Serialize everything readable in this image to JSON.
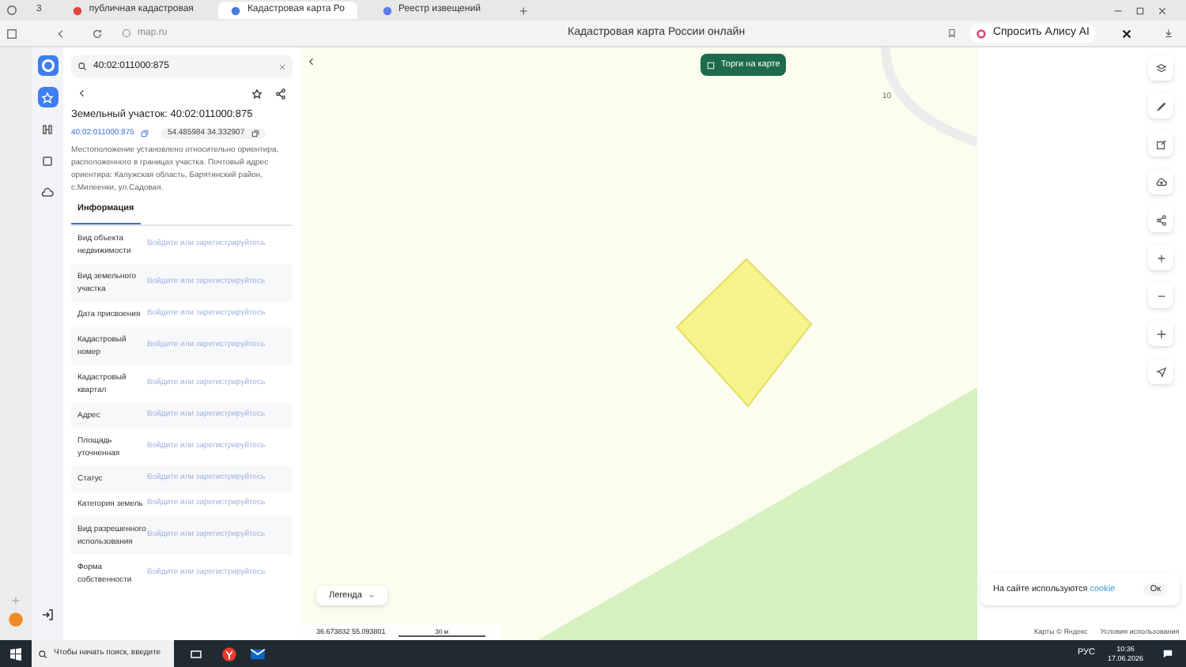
{
  "browser": {
    "tab_count": "3",
    "tabs": [
      {
        "label": "публичная кадастровая",
        "selected": false
      },
      {
        "label": "Кадастровая карта Ро",
        "selected": true
      },
      {
        "label": "Реестр извещений",
        "selected": false
      }
    ],
    "address": "map.ru",
    "page_title": "Кадастровая карта России онлайн",
    "alice": "Спросить Алису AI"
  },
  "rail": [
    {
      "kind": "star",
      "selected": true
    },
    {
      "kind": "ruler",
      "selected": false
    },
    {
      "kind": "square",
      "selected": false
    },
    {
      "kind": "cloud",
      "selected": false
    }
  ],
  "panel": {
    "search": "40:02:011000:875",
    "title": "Земельный участок: 40:02:011000:875",
    "number": "40:02:011000:875",
    "coords": "54.485984 34.332907",
    "description": "Местоположение установлено относительно ориентира, расположенного в границах участка. Почтовый адрес ориентира: Калужская область, Барятинский район, с.Милеенки, ул.Садовая.",
    "tab": "Информация",
    "rows": [
      {
        "label": "Вид объекта недвижимости",
        "value": "Войдите или зарегистрируйтесь"
      },
      {
        "label": "Вид земельного участка",
        "value": "Войдите или зарегистрируйтесь"
      },
      {
        "label": "Дата присвоения",
        "value": "Войдите или зарегистрируйтесь"
      },
      {
        "label": "Кадастровый номер",
        "value": "Войдите или зарегистрируйтесь"
      },
      {
        "label": "Кадастровый квартал",
        "value": "Войдите или зарегистрируйтесь"
      },
      {
        "label": "Адрес",
        "value": "Войдите или зарегистрируйтесь"
      },
      {
        "label": "Площадь уточненная",
        "value": "Войдите или зарегистрируйтесь"
      },
      {
        "label": "Статус",
        "value": "Войдите или зарегистрируйтесь"
      },
      {
        "label": "Категория земель",
        "value": "Войдите или зарегистрируйтесь"
      },
      {
        "label": "Вид разрешенного использования",
        "value": "Войдите или зарегистрируйтесь"
      },
      {
        "label": "Форма собственности",
        "value": "Войдите или зарегистрируйтесь"
      }
    ]
  },
  "map": {
    "auction_button": "Торги на карте",
    "label": "10",
    "legend": "Легенда",
    "coordinates": "36.673832 55.093801",
    "scale": "30 м",
    "cookie_text": "На сайте используются",
    "cookie_link": "cookie",
    "cookie_ok": "Ок",
    "footer": [
      "Карты © Яндекс",
      "Условия использования"
    ]
  },
  "taskbar": {
    "search": "Чтобы начать поиск, введите",
    "lang": "РУС",
    "time": "10:36",
    "date": "17.06.2026"
  }
}
